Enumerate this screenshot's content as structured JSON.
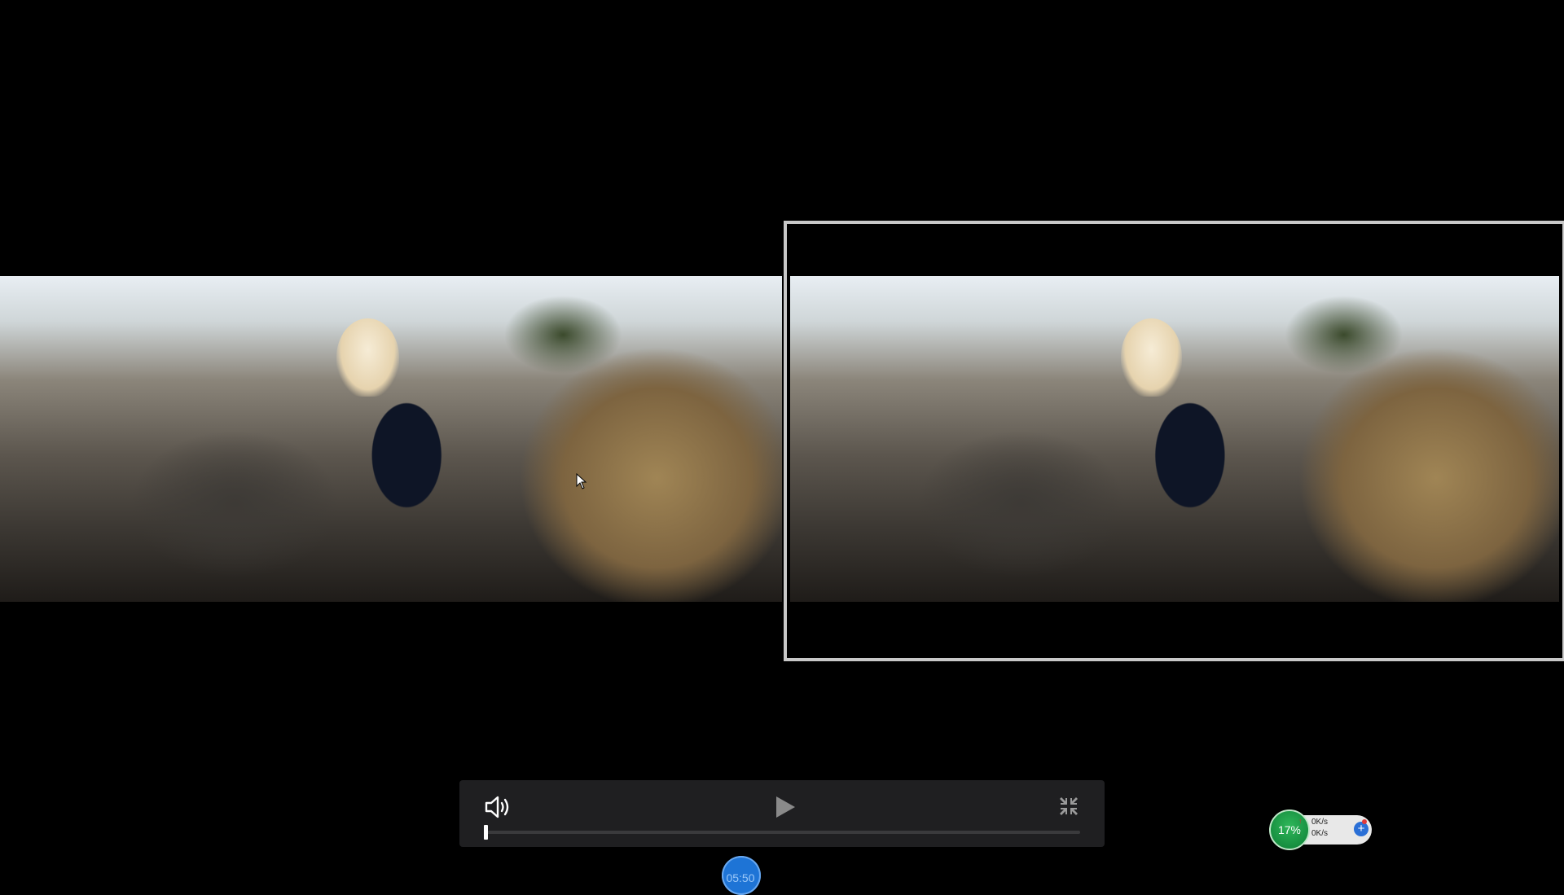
{
  "player": {
    "left_video": {
      "description": "video-frame"
    },
    "right_video": {
      "description": "video-frame"
    },
    "controls": {
      "volume_icon": "speaker-icon",
      "play_icon": "play-icon",
      "exit_fullscreen_icon": "collapse-icon",
      "progress": 0.0,
      "time_tooltip": "05:50"
    }
  },
  "system_monitor": {
    "cpu_percent": "17%",
    "upload_speed": "0K/s",
    "download_speed": "0K/s",
    "add_icon": "plus-icon",
    "colors": {
      "cpu": "#1f9d4a",
      "accent": "#2a6fd6"
    }
  }
}
